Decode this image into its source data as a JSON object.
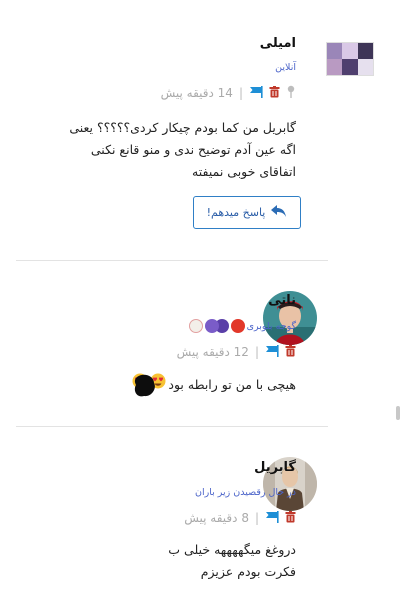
{
  "comments": [
    {
      "name": "امیلی",
      "status": "آنلاین",
      "time": "14 دقیقه پیش",
      "separator": "|",
      "text": "گابریل من کما بودم چیکار کردی؟؟؟؟؟ یعنی اگه عین آدم توضیح ندی و منو قانع نکنی اتفاقای خوبی نمیفته",
      "reply_label": "پاسخ میدهم!",
      "pin_icon": "pin-icon",
      "delete_icon": "trash-icon",
      "flag_icon": "flag-icon"
    },
    {
      "name": "ناتی",
      "status": "گوجه بلوبری",
      "time": "12 دقیقه پیش",
      "separator": "|",
      "text": "هیچی با من تو رابطه بود",
      "delete_icon": "trash-icon",
      "flag_icon": "flag-icon"
    },
    {
      "name": "گابریل",
      "status": "در حال رقصیدن زیر باران",
      "time": "8 دقیقه پیش",
      "separator": "|",
      "text": "دروغغ میگههههه خیلی ب فکرت بودم عزیزم",
      "delete_icon": "trash-icon",
      "flag_icon": "flag-icon"
    }
  ],
  "colors": {
    "accent": "#2f7fc6",
    "status": "#4a63c9",
    "delete": "#c0392b",
    "flag": "#1e8fd6",
    "muted": "#aaaaaa"
  }
}
